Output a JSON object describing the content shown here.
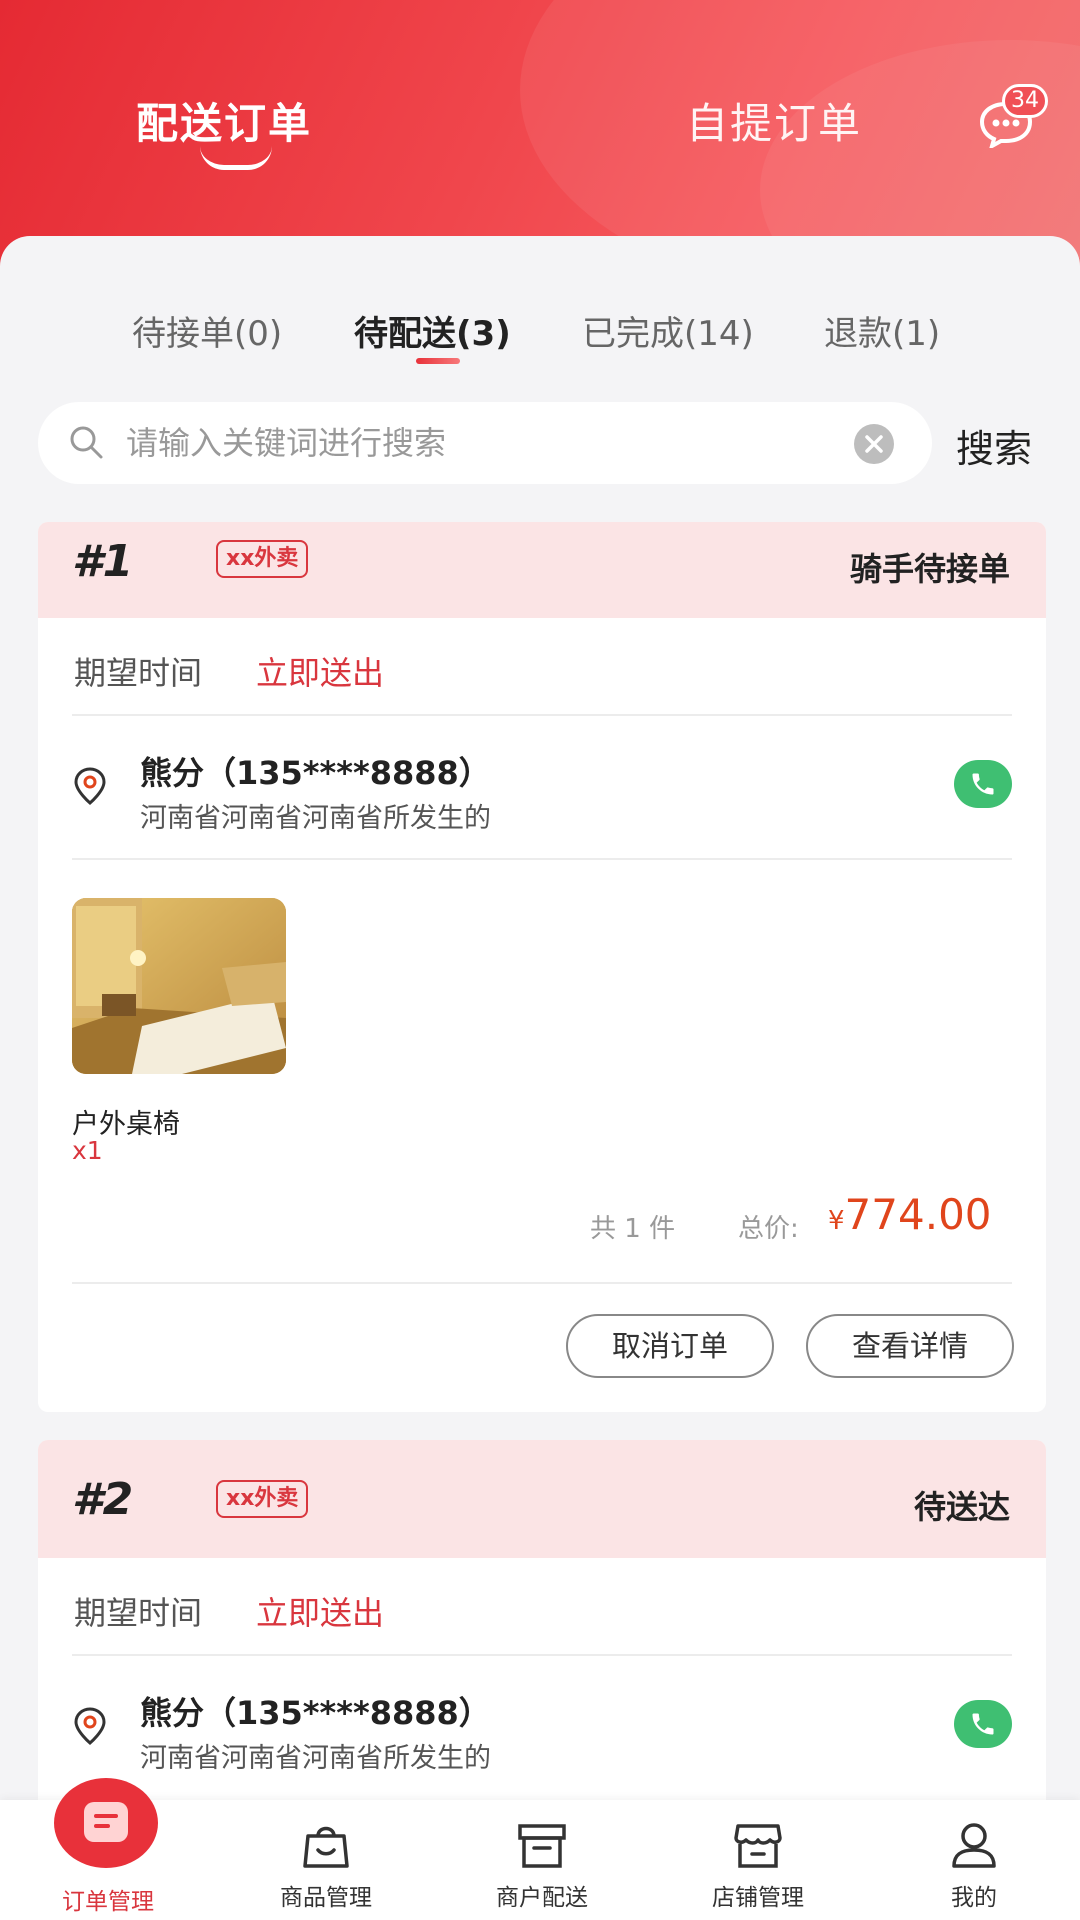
{
  "header": {
    "tab_active": "配送订单",
    "tab_inactive": "自提订单",
    "message_count": "34"
  },
  "subtabs": [
    {
      "label": "待接单(0)"
    },
    {
      "label": "待配送(3)"
    },
    {
      "label": "已完成(14)"
    },
    {
      "label": "退款(1)"
    }
  ],
  "search": {
    "placeholder": "请输入关键词进行搜索",
    "button_label": "搜索"
  },
  "orders": [
    {
      "number": "#1",
      "platform": "xx外卖",
      "status": "骑手待接单",
      "time_label": "期望时间",
      "time_value": "立即送出",
      "customer": "熊分（135****8888）",
      "address": "河南省河南省河南省所发生的",
      "product_name": "户外桌椅",
      "product_qty": "x1",
      "total_count": "共 1 件",
      "total_label": "总价:",
      "currency": "¥",
      "total_price": "774.00",
      "cancel_label": "取消订单",
      "detail_label": "查看详情"
    },
    {
      "number": "#2",
      "platform": "xx外卖",
      "status": "待送达",
      "time_label": "期望时间",
      "time_value": "立即送出",
      "customer": "熊分（135****8888）",
      "address": "河南省河南省河南省所发生的"
    }
  ],
  "tabbar": [
    {
      "label": "订单管理",
      "icon": "order-icon"
    },
    {
      "label": "商品管理",
      "icon": "bag-icon"
    },
    {
      "label": "商户配送",
      "icon": "box-icon"
    },
    {
      "label": "店铺管理",
      "icon": "store-icon"
    },
    {
      "label": "我的",
      "icon": "user-icon"
    }
  ],
  "colors": {
    "brand_red": "#e8313a",
    "price_orange": "#e0451c",
    "call_green": "#3fbf72",
    "card_head_pink": "#fbe4e5"
  }
}
